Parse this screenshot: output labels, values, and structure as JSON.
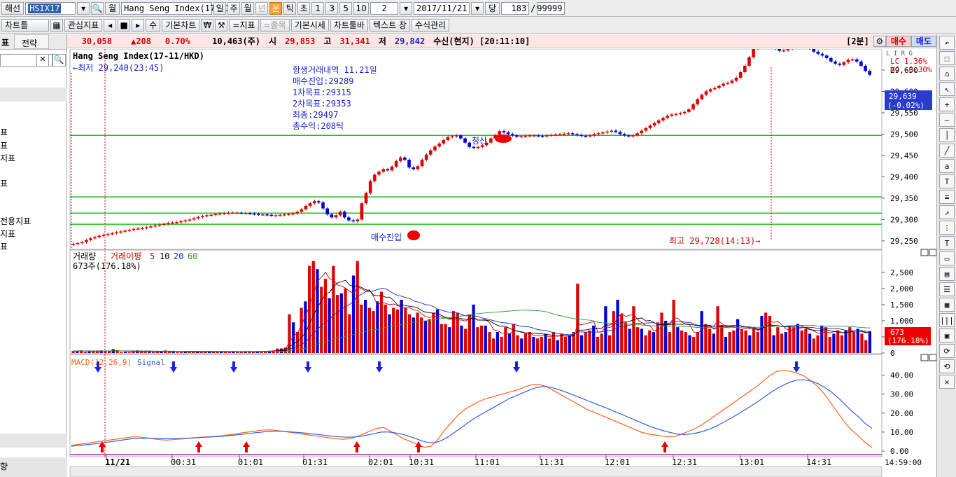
{
  "toolbar1": {
    "mode": "해선",
    "code": "HSIX17",
    "week_btn": "월",
    "title": "Hang Seng Index(17-11",
    "periods": [
      "일",
      "주",
      "월",
      "년",
      "분",
      "틱",
      "초"
    ],
    "active_period": "분",
    "minute_opts": [
      "1",
      "3",
      "5",
      "10"
    ],
    "interval": "2",
    "date": "2017/11/21",
    "dang": "당",
    "count": "183",
    "max": "99999"
  },
  "toolbar2": {
    "items": [
      "차트틀",
      "관심지표",
      "수",
      "기본차트",
      "₩",
      "=지표",
      "=종목",
      "기본시세",
      "차트툴바",
      "텍스트 창",
      "수식관리"
    ]
  },
  "quote": {
    "price": "30,058",
    "change": "▲208",
    "pct": "0.70%",
    "volume": "10,463(주)",
    "open_label": "시",
    "open": "29,853",
    "high_label": "고",
    "high": "31,341",
    "low_label": "저",
    "low": "29,842",
    "recv": "수신(현지) [20:11:10]",
    "period_badge": "[2분]",
    "sell": "매수",
    "buy": "매도"
  },
  "left_panel": {
    "tab1": "표",
    "tab2": "전략",
    "items": [
      "표",
      "표",
      "지표",
      "표",
      "전용지표",
      "지표",
      "표"
    ],
    "bottom": "향"
  },
  "price_chart": {
    "title": "Hang Seng Index(17-11/HKD)",
    "min_label": "←최저 29,240(23:45)",
    "max_label": "최고 29,728(14:13)→",
    "note_lines": [
      "항생거래내역 11.21일",
      "매수진입:29289",
      "1차목표:29315",
      "2차목표:29353",
      "최종:29497",
      "총수익:208틱"
    ],
    "sell_label": "청산",
    "buy_label": "매수진입",
    "lc": "LC 1.36%",
    "hc": "HC -0.30%",
    "current": "29,639",
    "current_pct": "(-0.02%)",
    "lrg": "L I R G"
  },
  "volume_chart": {
    "title": "거래량",
    "ma_title": "거래이평",
    "ma_periods": [
      "5",
      "10",
      "20",
      "60"
    ],
    "sub": "673주(176.18%)",
    "current": "673",
    "current_pct": "(176.18%)"
  },
  "macd_chart": {
    "title": "MACD(12,26,9)",
    "signal": "Signal"
  },
  "time_axis": {
    "labels": [
      "11/21",
      "00:31",
      "01:01",
      "01:31",
      "02:01",
      "10:31",
      "11:01",
      "11:31",
      "12:01",
      "12:31",
      "13:01",
      "14:31"
    ],
    "end": "14:59:00"
  },
  "colors": {
    "up": "#e00000",
    "down": "#0000e0",
    "level": "#20c020",
    "macd": "#ff6020",
    "signal": "#3060e0"
  },
  "chart_data": [
    {
      "type": "candlestick",
      "y_ticks": [
        29250,
        29300,
        29350,
        29400,
        29450,
        29500,
        29550,
        29600,
        29650
      ],
      "levels": [
        29289,
        29315,
        29353,
        29497
      ],
      "closes": [
        29243,
        29245,
        29247,
        29252,
        29256,
        29259,
        29262,
        29264,
        29266,
        29268,
        29270,
        29272,
        29274,
        29276,
        29278,
        29279,
        29280,
        29282,
        29284,
        29286,
        29288,
        29290,
        29292,
        29293,
        29294,
        29296,
        29298,
        29300,
        29303,
        29306,
        29308,
        29310,
        29311,
        29313,
        29314,
        29315,
        29316,
        29316,
        29316,
        29315,
        29315,
        29314,
        29313,
        29312,
        29312,
        29311,
        29310,
        29310,
        29311,
        29312,
        29313,
        29314,
        29318,
        29324,
        29332,
        29338,
        29343,
        29340,
        29326,
        29312,
        29305,
        29310,
        29318,
        29305,
        29298,
        29296,
        29300,
        29338,
        29362,
        29390,
        29405,
        29412,
        29418,
        29415,
        29424,
        29437,
        29445,
        29440,
        29422,
        29418,
        29425,
        29440,
        29452,
        29462,
        29471,
        29478,
        29486,
        29493,
        29495,
        29497,
        29490,
        29480,
        29470,
        29468,
        29470,
        29474,
        29480,
        29490,
        29498,
        29507,
        29504,
        29500,
        29497,
        29494,
        29495,
        29496,
        29497,
        29497,
        29496,
        29495,
        29497,
        29498,
        29499,
        29500,
        29501,
        29502,
        29500,
        29498,
        29496,
        29495,
        29497,
        29500,
        29502,
        29504,
        29506,
        29508,
        29505,
        29500,
        29497,
        29495,
        29497,
        29502,
        29508,
        29514,
        29520,
        29526,
        29532,
        29538,
        29543,
        29546,
        29547,
        29549,
        29552,
        29558,
        29570,
        29582,
        29592,
        29600,
        29605,
        29608,
        29613,
        29618,
        29620,
        29625,
        29632,
        29645,
        29660,
        29680,
        29700,
        29710,
        29718,
        29724,
        29712,
        29700,
        29695,
        29696,
        29700,
        29705,
        29710,
        29713,
        29708,
        29700,
        29693,
        29688,
        29684,
        29678,
        29670,
        29665,
        29662,
        29668,
        29674,
        29675,
        29670,
        29660,
        29648,
        29639
      ]
    },
    {
      "type": "bar",
      "y_ticks": [
        0,
        500,
        1000,
        1500,
        2000,
        2500
      ],
      "values": [
        60,
        70,
        80,
        40,
        50,
        60,
        70,
        80,
        65,
        55,
        120,
        60,
        30,
        40,
        25,
        60,
        80,
        45,
        60,
        55,
        30,
        40,
        50,
        80,
        45,
        60,
        30,
        25,
        40,
        35,
        25,
        45,
        30,
        40,
        60,
        30,
        40,
        60,
        50,
        30,
        45,
        35,
        40,
        50,
        60,
        45,
        50,
        55,
        60,
        70,
        80,
        140,
        140,
        170,
        1200,
        950,
        650,
        1400,
        1600,
        2700,
        2850,
        2600,
        2050,
        2300,
        1700,
        2700,
        1800,
        1850,
        2000,
        1200,
        2400,
        2850,
        1500,
        1650,
        1400,
        1300,
        1600,
        1900,
        1500,
        1200,
        1400,
        1350,
        1650,
        1400,
        1200,
        1100,
        1250,
        1100,
        1000,
        1050,
        1250,
        1350,
        900,
        900,
        800,
        1300,
        1250,
        850,
        750,
        1200,
        1500,
        800,
        850,
        850,
        650,
        450,
        650,
        500,
        800,
        600,
        900,
        550,
        450,
        600,
        650,
        500,
        450,
        500,
        600,
        450,
        650,
        400,
        600,
        500,
        550,
        650,
        2150,
        550,
        650,
        700,
        850,
        500,
        600,
        1450,
        550,
        1300,
        1650,
        1200,
        950,
        750,
        1450,
        800,
        750,
        550,
        700,
        650,
        950,
        1250,
        1000,
        650,
        1650,
        800,
        700,
        650,
        550,
        500,
        650,
        1300,
        900,
        750,
        600,
        1450,
        850,
        500,
        650,
        700,
        1050,
        750,
        700,
        550,
        800,
        650,
        1150,
        1250,
        1150,
        550,
        800,
        600,
        650,
        850,
        800,
        900,
        700,
        750,
        600,
        450,
        550,
        850,
        800,
        500,
        600,
        700,
        550,
        700,
        800,
        650,
        750,
        600,
        400,
        673
      ]
    },
    {
      "type": "line",
      "y_ticks": [
        0,
        10,
        20,
        30,
        40
      ],
      "series": [
        {
          "name": "MACD(12,26,9)",
          "values": [
            3,
            3.5,
            4,
            4.5,
            5,
            5.5,
            6,
            6.5,
            7,
            7.5,
            7.5,
            7,
            6.5,
            6,
            5.8,
            6,
            6.3,
            6.6,
            7,
            7.3,
            7.5,
            7.7,
            8,
            8.5,
            9,
            9.5,
            10,
            10.5,
            11,
            11.2,
            11,
            10.5,
            10,
            9.5,
            9,
            8.5,
            8,
            7.5,
            7,
            6.5,
            6.2,
            6.5,
            7.5,
            9,
            10.5,
            12,
            12.5,
            10.5,
            8.5,
            6.5,
            5,
            3.5,
            2,
            2.5,
            6,
            11,
            15,
            19,
            22,
            24,
            26,
            27.5,
            28.5,
            29.5,
            30.5,
            31.5,
            32.5,
            34,
            35,
            35,
            34,
            32,
            30,
            28,
            26,
            24,
            22,
            20.5,
            19,
            17.5,
            16,
            14.5,
            13,
            11.5,
            10,
            9,
            8.5,
            8,
            7.5,
            7.8,
            9,
            10.5,
            12,
            14,
            16.5,
            19,
            21.5,
            24,
            26.5,
            29,
            31.5,
            34,
            37,
            40,
            42,
            42.5,
            42,
            41,
            39.5,
            37,
            34,
            30,
            25,
            20,
            15,
            11,
            8,
            4.5,
            2
          ]
        },
        {
          "name": "Signal",
          "values": [
            2.5,
            3,
            3.3,
            3.6,
            4,
            4.5,
            5,
            5.5,
            6,
            6.5,
            6.8,
            6.8,
            6.7,
            6.6,
            6.5,
            6.5,
            6.6,
            6.7,
            6.9,
            7.1,
            7.3,
            7.5,
            7.7,
            8,
            8.3,
            8.7,
            9.1,
            9.5,
            9.9,
            10.3,
            10.5,
            10.5,
            10.3,
            10,
            9.7,
            9.4,
            9,
            8.6,
            8.2,
            7.8,
            7.5,
            7.3,
            7.4,
            7.8,
            8.4,
            9.2,
            10,
            10.1,
            9.7,
            9,
            8,
            6.8,
            5.5,
            4.5,
            4.3,
            5.5,
            7.5,
            10,
            12.5,
            15,
            17.5,
            19.5,
            21.5,
            23.5,
            25.5,
            27.5,
            29,
            30.5,
            32,
            33.3,
            34,
            33.7,
            32.9,
            31.7,
            30.4,
            29,
            27.6,
            26.2,
            24.8,
            23.4,
            22,
            20.5,
            19,
            17.5,
            16,
            14.5,
            13,
            11.8,
            10.7,
            9.8,
            9,
            8.7,
            9,
            9.6,
            10.5,
            11.8,
            13.4,
            15.3,
            17.3,
            19.3,
            21.5,
            23.7,
            26,
            28.5,
            31,
            33.2,
            35,
            36.5,
            37.5,
            37.5,
            36.8,
            35.5,
            33.5,
            31,
            28,
            24.5,
            21,
            18,
            14.5,
            12
          ]
        }
      ]
    }
  ]
}
